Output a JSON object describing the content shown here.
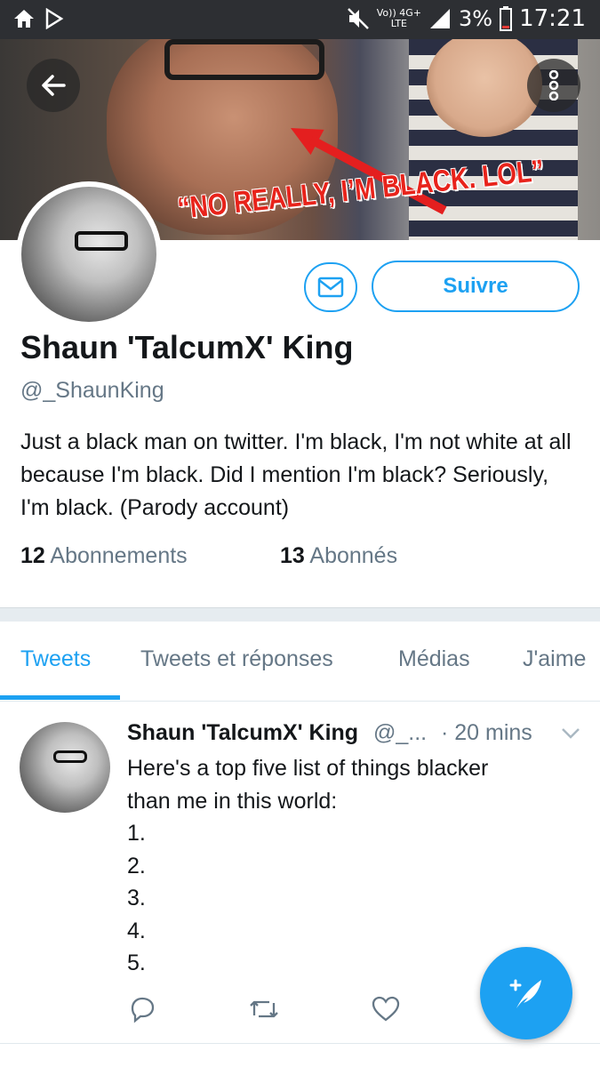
{
  "status_bar": {
    "battery_percent": "3%",
    "time": "17:21",
    "network_top": "Vo)) 4G+",
    "network_bottom": "LTE"
  },
  "banner": {
    "caption": "“NO REALLY, I’M BLACK. LOL”"
  },
  "profile": {
    "name": "Shaun 'TalcumX' King",
    "handle": "@_ShaunKing",
    "bio": "Just a black man on twitter. I'm black, I'm not white at all because I'm black. Did I mention I'm black? Seriously, I'm black. (Parody account)",
    "following_count": "12",
    "following_label": "Abonnements",
    "followers_count": "13",
    "followers_label": "Abonnés",
    "follow_label": "Suivre"
  },
  "tabs": [
    {
      "label": "Tweets",
      "active": true
    },
    {
      "label": "Tweets et réponses",
      "active": false
    },
    {
      "label": "Médias",
      "active": false
    },
    {
      "label": "J'aime",
      "active": false
    }
  ],
  "tweet": {
    "name": "Shaun 'TalcumX' King",
    "handle": "@_...",
    "time": "· 20 mins",
    "text": "Here's a top five list of things blacker\nthan me in this world:\n1.\n2.\n3.\n4.\n5."
  },
  "icons": {
    "back": "arrow-left-icon",
    "more": "more-vertical-icon",
    "message": "envelope-icon",
    "reply": "reply-icon",
    "retweet": "retweet-icon",
    "like": "heart-icon",
    "compose": "compose-feather-icon"
  },
  "colors": {
    "accent": "#1da1f2",
    "secondary_text": "#657786",
    "primary_text": "#14171a",
    "status_bar": "#2d2f33"
  }
}
